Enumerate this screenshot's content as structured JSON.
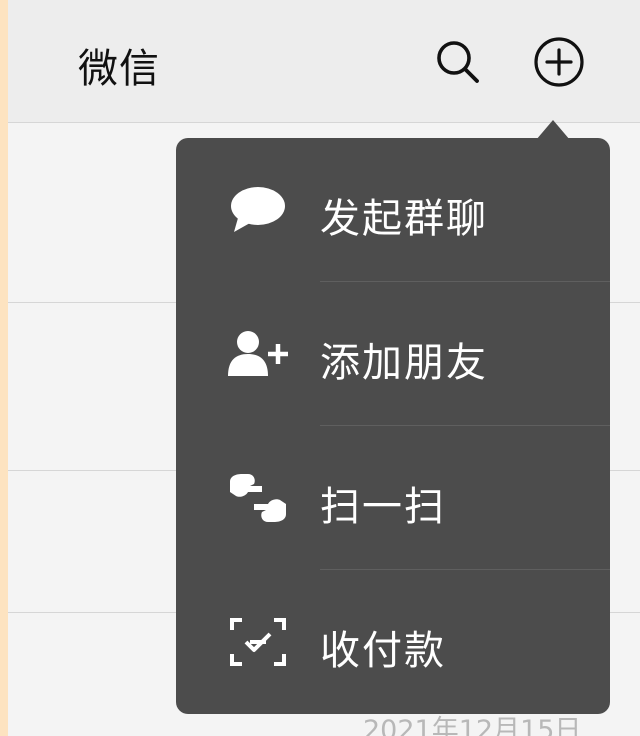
{
  "header": {
    "title": "微信",
    "search_icon": "search-icon",
    "add_icon": "plus-circle-icon"
  },
  "menu": {
    "items": [
      {
        "label": "发起群聊",
        "icon": "chat-bubble-icon"
      },
      {
        "label": "添加朋友",
        "icon": "add-friend-icon"
      },
      {
        "label": "扫一扫",
        "icon": "scan-icon"
      },
      {
        "label": "收付款",
        "icon": "payment-icon"
      }
    ]
  },
  "chat_list": {
    "timestamp": "2021年12月15日"
  },
  "colors": {
    "frame": "#fde3c0",
    "background": "#ededed",
    "menu_background": "#4c4c4c",
    "menu_text": "#ffffff"
  }
}
